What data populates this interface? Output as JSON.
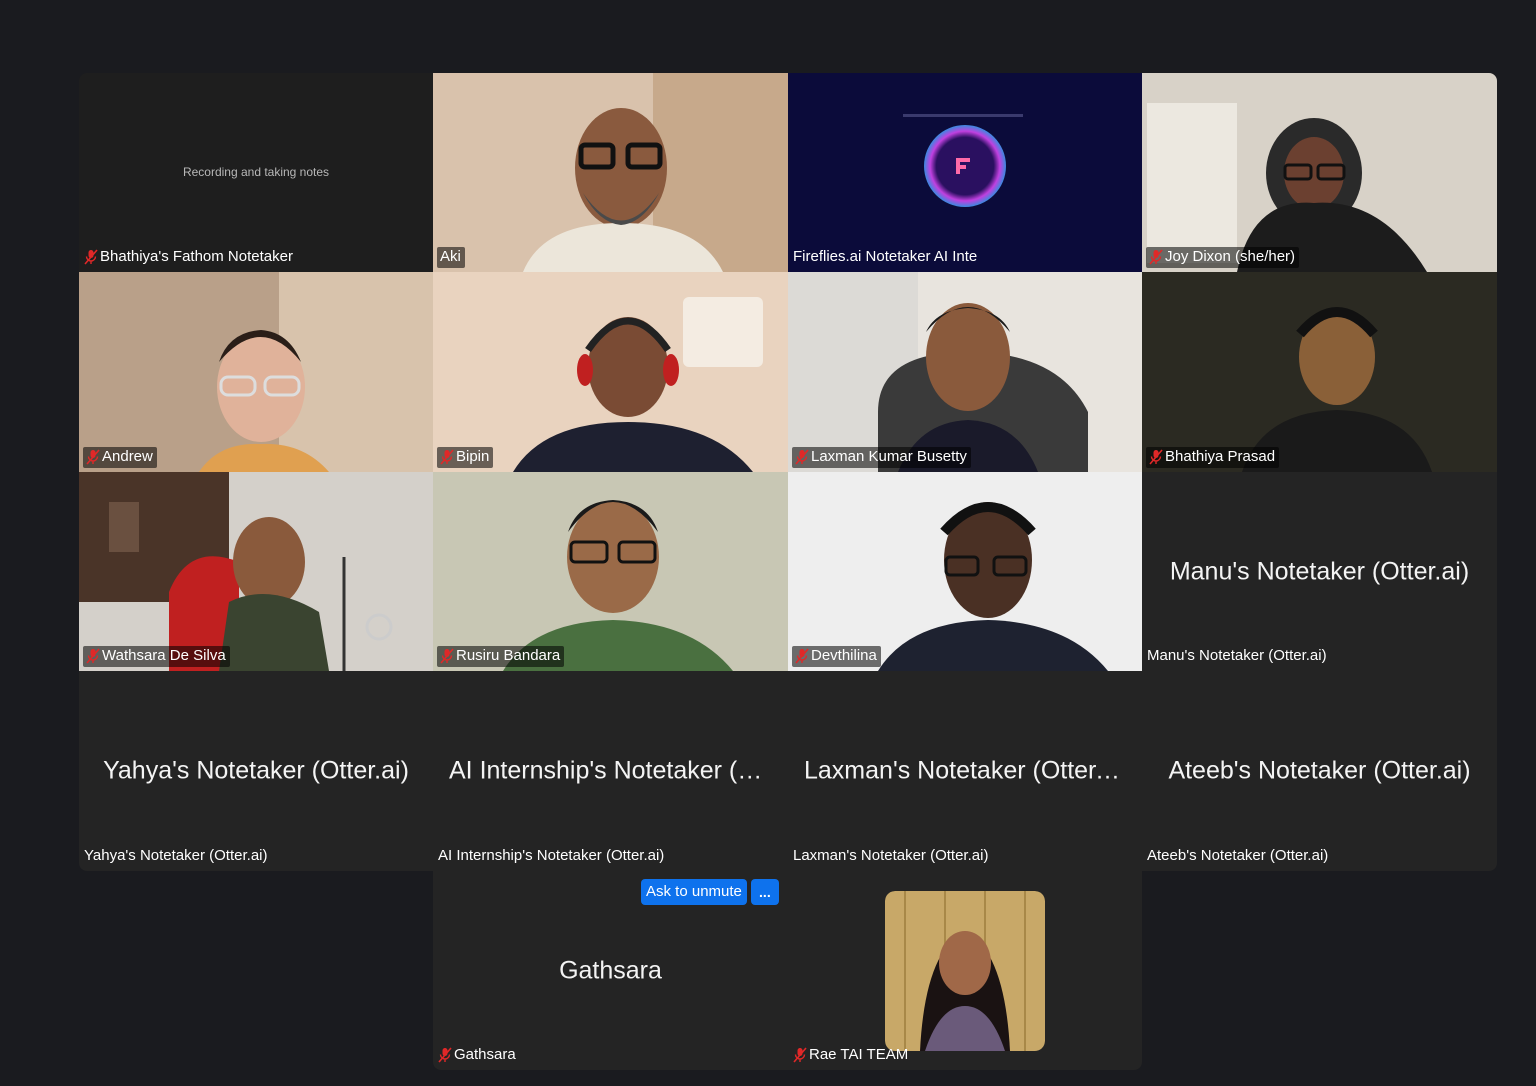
{
  "tiles": [
    {
      "name": "Bhathiya's Fathom Notetaker",
      "center_text": "Recording and taking notes"
    },
    {
      "name": "Aki"
    },
    {
      "name": "Fireflies.ai Notetaker AI Inte"
    },
    {
      "name": "Joy Dixon (she/her)"
    },
    {
      "name": "Andrew"
    },
    {
      "name": "Bipin"
    },
    {
      "name": "Laxman Kumar Busetty"
    },
    {
      "name": "Bhathiya Prasad"
    },
    {
      "name": "Wathsara De Silva"
    },
    {
      "name": "Rusiru Bandara"
    },
    {
      "name": "Devthilina"
    },
    {
      "name": "Manu's Notetaker (Otter.ai)",
      "big": "Manu's Notetaker (Otter.ai)"
    },
    {
      "name": "Yahya's Notetaker (Otter.ai)",
      "big": "Yahya's Notetaker (Otter.ai)"
    },
    {
      "name": "AI Internship's Notetaker (Otter.ai)",
      "big": "AI Internship's Notetaker (O..."
    },
    {
      "name": "Laxman's Notetaker (Otter.ai)",
      "big": "Laxman's Notetaker (Otter.ai)"
    },
    {
      "name": "Ateeb's Notetaker (Otter.ai)",
      "big": "Ateeb's Notetaker (Otter.ai)"
    },
    {
      "name": "Gathsara",
      "big": "Gathsara",
      "ask_unmute": "Ask to unmute",
      "more": "..."
    },
    {
      "name": "Rae TAI TEAM"
    }
  ],
  "colors": {
    "background": "#1a1b1f",
    "tile": "#242424",
    "active_border": "#6fbf6a",
    "button": "#0e72ed",
    "muted": "#e02828"
  }
}
